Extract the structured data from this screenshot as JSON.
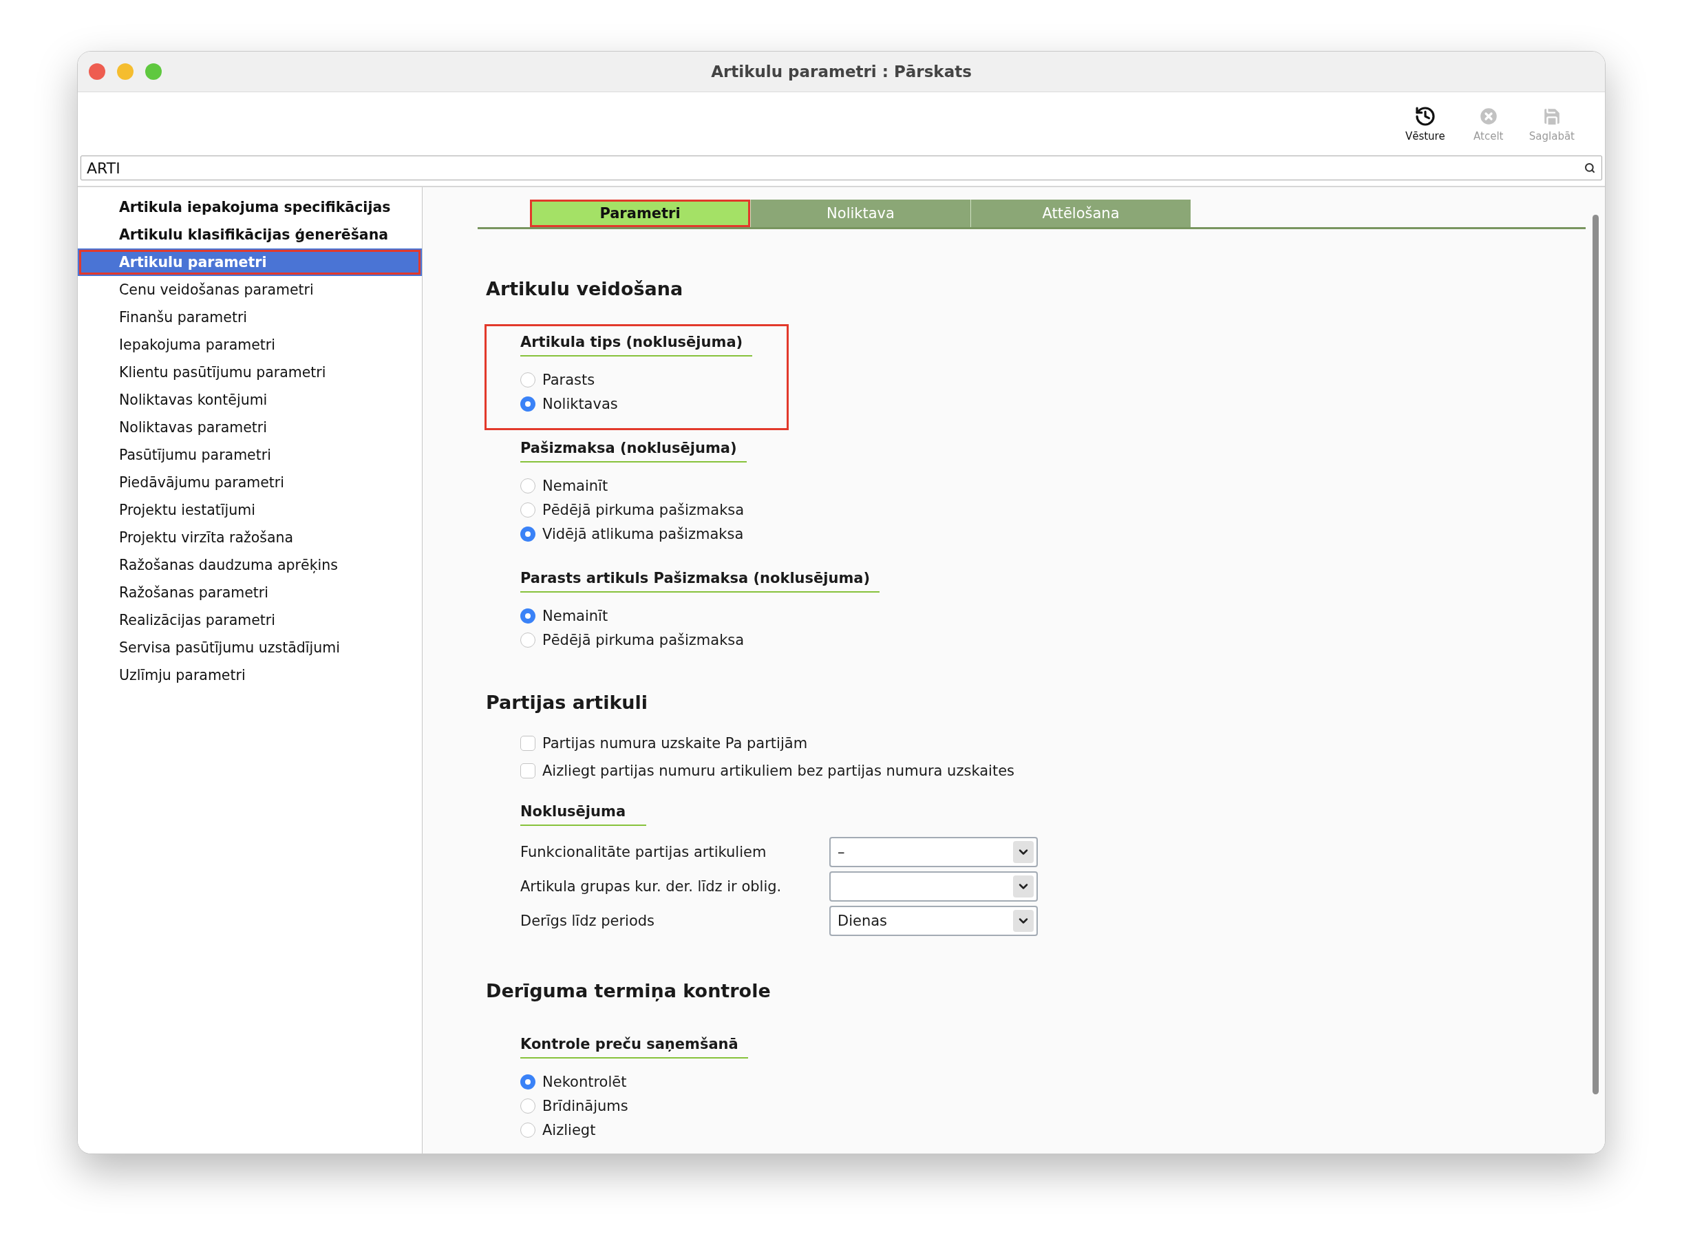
{
  "window": {
    "title": "Artikulu parametri : Pārskats"
  },
  "toolbar": {
    "buttons": [
      {
        "kind": "history",
        "label": "Vēsture",
        "disabled": false
      },
      {
        "kind": "cancel",
        "label": "Atcelt",
        "disabled": true
      },
      {
        "kind": "save",
        "label": "Saglabāt",
        "disabled": true
      }
    ]
  },
  "search": {
    "value": "ARTI"
  },
  "sidebar": {
    "items": [
      {
        "label": "Artikula iepakojuma specifikācijas",
        "bold": true,
        "selected": false,
        "marked": false
      },
      {
        "label": "Artikulu klasifikācijas ģenerēšana",
        "bold": true,
        "selected": false,
        "marked": false
      },
      {
        "label": "Artikulu parametri",
        "bold": true,
        "selected": true,
        "marked": true
      },
      {
        "label": "Cenu veidošanas parametri",
        "bold": false,
        "selected": false,
        "marked": false
      },
      {
        "label": "Finanšu parametri",
        "bold": false,
        "selected": false,
        "marked": false
      },
      {
        "label": "Iepakojuma parametri",
        "bold": false,
        "selected": false,
        "marked": false
      },
      {
        "label": "Klientu pasūtījumu parametri",
        "bold": false,
        "selected": false,
        "marked": false
      },
      {
        "label": "Noliktavas kontējumi",
        "bold": false,
        "selected": false,
        "marked": false
      },
      {
        "label": "Noliktavas parametri",
        "bold": false,
        "selected": false,
        "marked": false
      },
      {
        "label": "Pasūtījumu parametri",
        "bold": false,
        "selected": false,
        "marked": false
      },
      {
        "label": "Piedāvājumu parametri",
        "bold": false,
        "selected": false,
        "marked": false
      },
      {
        "label": "Projektu iestatījumi",
        "bold": false,
        "selected": false,
        "marked": false
      },
      {
        "label": "Projektu virzīta ražošana",
        "bold": false,
        "selected": false,
        "marked": false
      },
      {
        "label": "Ražošanas daudzuma aprēķins",
        "bold": false,
        "selected": false,
        "marked": false
      },
      {
        "label": "Ražošanas parametri",
        "bold": false,
        "selected": false,
        "marked": false
      },
      {
        "label": "Realizācijas parametri",
        "bold": false,
        "selected": false,
        "marked": false
      },
      {
        "label": "Servisa pasūtījumu uzstādījumi",
        "bold": false,
        "selected": false,
        "marked": false
      },
      {
        "label": "Uzlīmju parametri",
        "bold": false,
        "selected": false,
        "marked": false
      }
    ]
  },
  "tabs": [
    {
      "label": "Parametri",
      "selected": true,
      "marked": true
    },
    {
      "label": "Noliktava",
      "selected": false,
      "marked": false
    },
    {
      "label": "Attēlošana",
      "selected": false,
      "marked": false
    }
  ],
  "sections": [
    {
      "title": "Artikulu veidošana",
      "blocks": [
        {
          "kind": "radio",
          "title": "Artikula tips (noklusējuma)",
          "marked": true,
          "options": [
            {
              "label": "Parasts",
              "selected": false
            },
            {
              "label": "Noliktavas",
              "selected": true
            }
          ]
        },
        {
          "kind": "radio",
          "title": "Pašizmaksa (noklusējuma)",
          "marked": false,
          "options": [
            {
              "label": "Nemainīt",
              "selected": false
            },
            {
              "label": "Pēdējā pirkuma pašizmaksa",
              "selected": false
            },
            {
              "label": "Vidējā atlikuma pašizmaksa",
              "selected": true
            }
          ]
        },
        {
          "kind": "radio",
          "title": "Parasts artikuls Pašizmaksa (noklusējuma)",
          "marked": false,
          "options": [
            {
              "label": "Nemainīt",
              "selected": true
            },
            {
              "label": "Pēdējā pirkuma pašizmaksa",
              "selected": false
            }
          ]
        }
      ]
    },
    {
      "title": "Partijas artikuli",
      "blocks": [
        {
          "kind": "checkbox",
          "marked": false,
          "options": [
            {
              "label": "Partijas numura uzskaite Pa partijām",
              "checked": false
            },
            {
              "label": "Aizliegt partijas numuru artikuliem bez partijas numura uzskaites",
              "checked": false
            }
          ]
        },
        {
          "kind": "fields",
          "title": "Noklusējuma",
          "marked": false,
          "fields": [
            {
              "label": "Funkcionalitāte partijas artikuliem",
              "value": "–"
            },
            {
              "label": "Artikula grupas kur. der. līdz ir oblig."
            },
            {
              "label": "Derīgs līdz periods",
              "value": "Dienas"
            }
          ]
        }
      ]
    },
    {
      "title": "Derīguma termiņa kontrole",
      "blocks": [
        {
          "kind": "radio",
          "title": "Kontrole preču saņemšanā",
          "marked": false,
          "options": [
            {
              "label": "Nekontrolēt",
              "selected": true
            },
            {
              "label": "Brīdinājums",
              "selected": false
            },
            {
              "label": "Aizliegt",
              "selected": false
            }
          ]
        }
      ]
    }
  ]
}
